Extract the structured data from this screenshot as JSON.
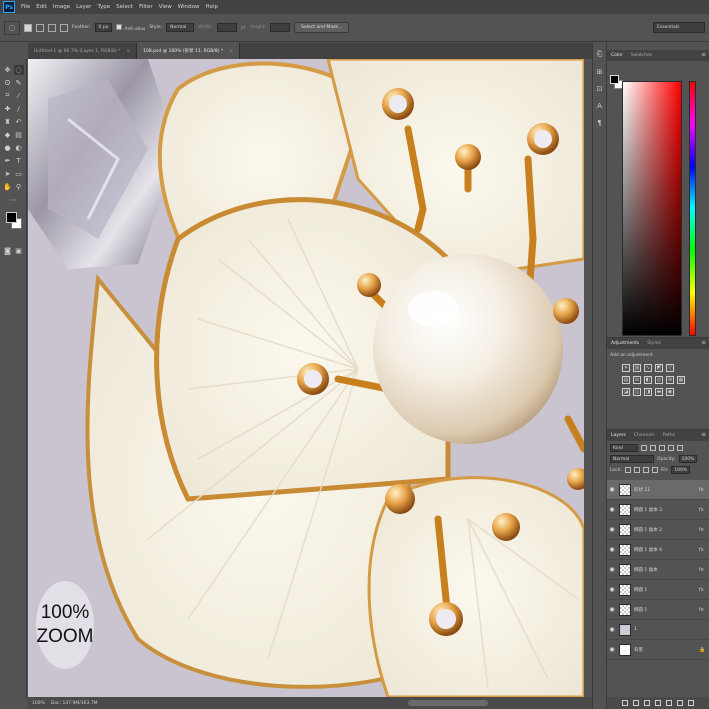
{
  "app": {
    "logo": "Ps"
  },
  "menu": [
    "File",
    "Edit",
    "Image",
    "Layer",
    "Type",
    "Select",
    "Filter",
    "View",
    "Window",
    "Help"
  ],
  "options": {
    "feather_label": "Feather:",
    "feather_value": "0 px",
    "antialias_label": "Anti-alias",
    "style_label": "Style:",
    "style_value": "Normal",
    "width_label": "Width:",
    "height_label": "Height:",
    "select_mask_label": "Select and Mask...",
    "workspace": "Essentials"
  },
  "tabs": [
    {
      "label": "Untitled-1 @ 66.7% (Layer 1, RGB/8) *",
      "active": false
    },
    {
      "label": "108.psd @ 100% (形状 11, RGB/8) *",
      "active": true
    }
  ],
  "canvas": {
    "zoom_line1": "100%",
    "zoom_line2": "ZOOM"
  },
  "status": {
    "zoom": "100%",
    "doc": "Doc: 147.9M/363.7M"
  },
  "color_panel": {
    "tabs": [
      "Color",
      "Swatches"
    ]
  },
  "adjustments_panel": {
    "tabs": [
      "Adjustments",
      "Styles"
    ],
    "add_label": "Add an adjustment"
  },
  "layers_panel": {
    "tabs": [
      "Layers",
      "Channels",
      "Paths"
    ],
    "kind_label": "Kind",
    "blend_mode": "Normal",
    "opacity_label": "Opacity:",
    "opacity_value": "100%",
    "lock_label": "Lock:",
    "fill_label": "Fill:",
    "fill_value": "100%",
    "layers": [
      {
        "name": "形状 11",
        "fx": "fx",
        "thumb": "checker",
        "selected": true
      },
      {
        "name": "椭圆 1 副本 3",
        "fx": "fx",
        "thumb": "checker",
        "selected": false
      },
      {
        "name": "椭圆 1 副本 2",
        "fx": "fx",
        "thumb": "checker",
        "selected": false
      },
      {
        "name": "椭圆 1 副本 4",
        "fx": "fx",
        "thumb": "checker",
        "selected": false
      },
      {
        "name": "椭圆 1 副本",
        "fx": "fx",
        "thumb": "checker",
        "selected": false
      },
      {
        "name": "椭圆 1",
        "fx": "fx",
        "thumb": "checker",
        "selected": false
      },
      {
        "name": "椭圆 1",
        "fx": "fx",
        "thumb": "checker",
        "selected": false
      },
      {
        "name": "1",
        "fx": "",
        "thumb": "photo",
        "selected": false
      },
      {
        "name": "背景",
        "fx": "",
        "thumb": "white",
        "selected": false,
        "locked": true
      }
    ]
  },
  "colors": {
    "ps_blue": "#31a8ff",
    "chrome": "#535353",
    "dark_chrome": "#424242"
  }
}
